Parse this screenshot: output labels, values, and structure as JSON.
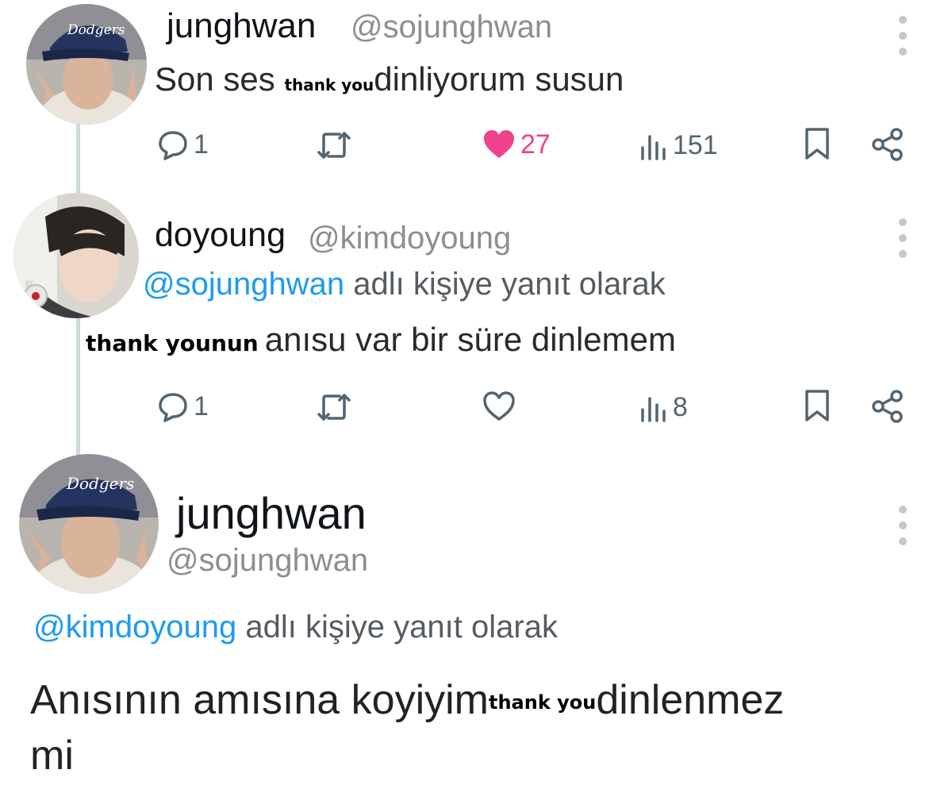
{
  "tweets": [
    {
      "name": "junghwan",
      "handle": "@sojunghwan",
      "body_before": "Son ses ",
      "sticker": "thank you",
      "body_after": "dinliyorum susun",
      "actions": {
        "replies": "1",
        "likes": "27",
        "views": "151"
      },
      "liked": true
    },
    {
      "name": "doyoung",
      "handle": "@kimdoyoung",
      "reply_mention": "@sojunghwan",
      "reply_text": "adlı kişiye yanıt olarak",
      "sticker": "thank younun",
      "body_after": "anısu var bir süre dinlemem",
      "actions": {
        "replies": "1",
        "likes": "",
        "views": "8"
      },
      "liked": false
    },
    {
      "name": "junghwan",
      "handle": "@sojunghwan",
      "reply_mention": "@kimdoyoung",
      "reply_text": "adlı kişiye yanıt olarak",
      "body_before": "Anısının amısına koyiyim",
      "sticker": "thank you",
      "body_after": "dinlenmez",
      "body_line2": "mi"
    }
  ],
  "avatars": [
    {
      "cap_text": "Dodgers"
    },
    {
      "cap_text": ""
    },
    {
      "cap_text": "Dodgers"
    }
  ],
  "colors": {
    "like": "#f0418b",
    "mention": "#1d9bf0",
    "icon": "#536471"
  }
}
